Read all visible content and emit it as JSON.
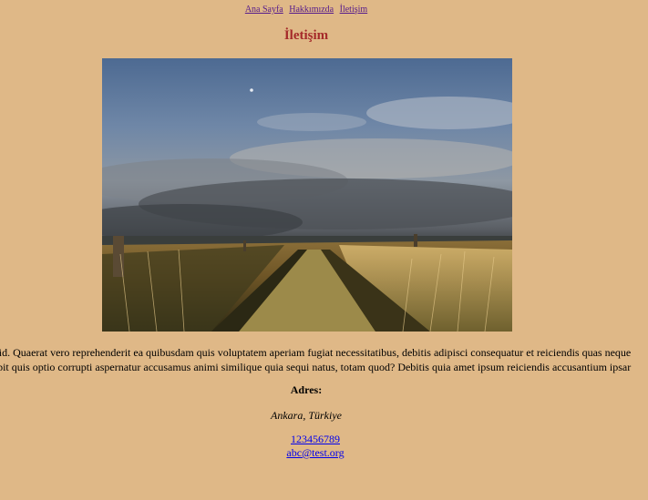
{
  "nav": {
    "items": [
      "Ana Sayfa",
      "Hakkımızda",
      "İletişim"
    ]
  },
  "page": {
    "title": "İletişim"
  },
  "content": {
    "paragraph_lines": [
      "ctio id. Quaerat vero reprehenderit ea quibusdam quis voluptatem aperiam fugiat necessitatibus, debitis adipisci consequatur et reiciendis quas neque",
      "uscipit quis optio corrupti aspernatur accusamus animi similique quia sequi natus, totam quod? Debitis quia amet ipsum reiciendis accusantium ipsar"
    ],
    "address_label": "Adres:",
    "address_value": "Ankara, Türkiye",
    "phone": "123456789",
    "email": "abc@test.org"
  },
  "colors": {
    "background": "#DFB887",
    "title": "#A52A2A",
    "link": "#0000EE",
    "visited_link": "#551A8B"
  }
}
